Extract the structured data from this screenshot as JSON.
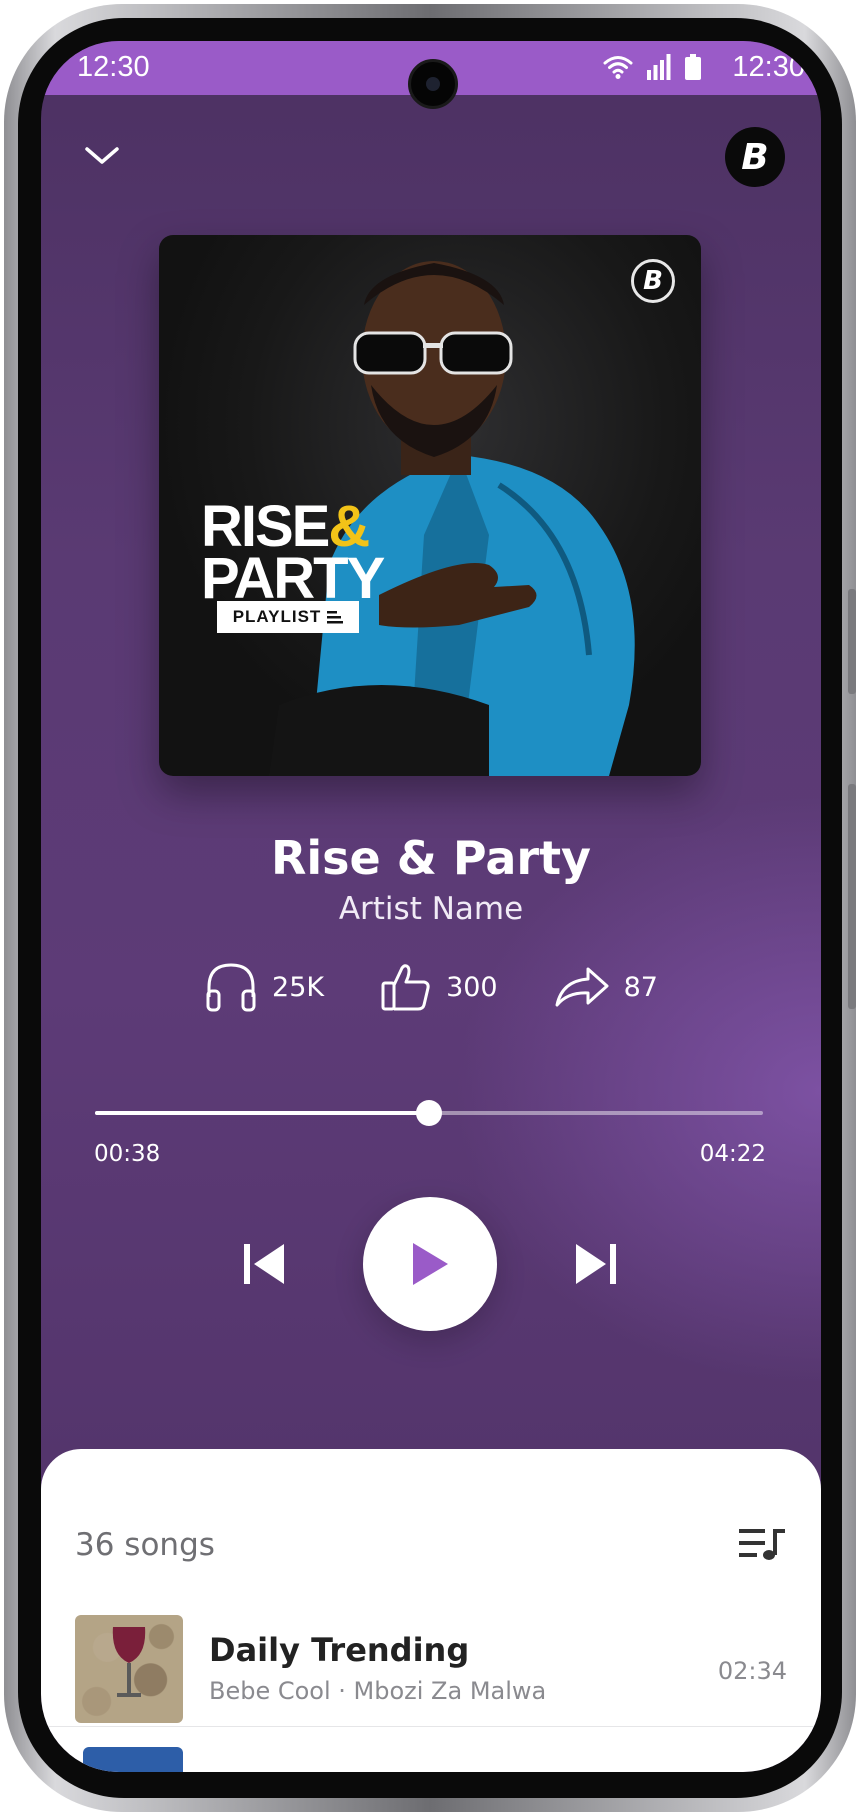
{
  "status_bar": {
    "time_left": "12:30",
    "time_right": "12:30",
    "icons": [
      "wifi-icon",
      "signal-icon",
      "battery-icon"
    ],
    "color": "#9a5bc8"
  },
  "header": {
    "collapse_icon": "chevron-down-icon",
    "logo_text": "B"
  },
  "cover": {
    "badge_text": "B",
    "title_line1_a": "RISE",
    "title_line1_b": "&",
    "title_line2": "PARTY",
    "tag": "PLAYLIST",
    "accent_color": "#f2c318"
  },
  "track": {
    "title": "Rise & Party",
    "artist": "Artist Name"
  },
  "stats": {
    "listens": "25K",
    "likes": "300",
    "shares": "87"
  },
  "player": {
    "elapsed": "00:38",
    "total": "04:22",
    "progress_fraction": 0.5,
    "state": "paused",
    "play_color": "#9a5bc8"
  },
  "songs": {
    "count_label": "36 songs",
    "queue_icon": "queue-music-icon",
    "items": [
      {
        "title": "Daily Trending",
        "meta": "Bebe Cool · Mbozi Za Malwa",
        "duration": "02:34"
      }
    ]
  }
}
